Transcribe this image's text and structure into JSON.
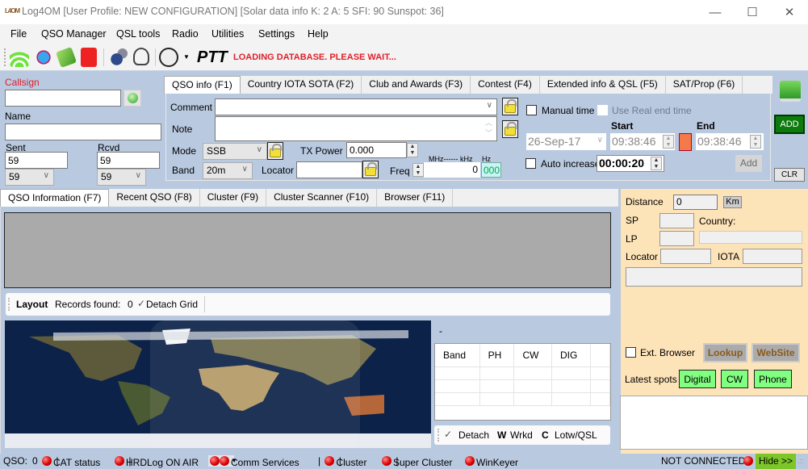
{
  "window": {
    "logo": "L4OM",
    "title": "Log4OM [User Profile: NEW CONFIGURATION] [Solar data info K: 2 A: 5 SFI: 90 Sunspot: 36]",
    "controls": {
      "minimize": "—",
      "maximize": "☐",
      "close": "✕"
    }
  },
  "menu": [
    "File",
    "QSO Manager",
    "QSL tools",
    "Radio",
    "Utilities",
    "Settings",
    "Help"
  ],
  "toolbar": {
    "icons": [
      "wifi-icon",
      "globe-icon",
      "book-icon",
      "mailbox-icon",
      "gears-icon",
      "headset-icon",
      "satellite-dish-icon"
    ],
    "ptt_label": "PTT",
    "status_message": "LOADING DATABASE. PLEASE WAIT..."
  },
  "left": {
    "callsign_label": "Callsign",
    "callsign_value": "",
    "name_label": "Name",
    "name_value": "",
    "sent_label": "Sent",
    "sent_value": "59",
    "sent_combo": "59",
    "rcvd_label": "Rcvd",
    "rcvd_value": "59",
    "rcvd_combo": "59"
  },
  "qso_tabs": [
    "QSO info (F1)",
    "Country IOTA SOTA (F2)",
    "Club and Awards (F3)",
    "Contest (F4)",
    "Extended info & QSL (F5)",
    "SAT/Prop (F6)"
  ],
  "qso_info": {
    "comment_label": "Comment",
    "comment_value": "",
    "note_label": "Note",
    "note_value": "",
    "mode_label": "Mode",
    "mode_value": "SSB",
    "txpower_label": "TX Power",
    "txpower_value": "0.000",
    "band_label": "Band",
    "band_value": "20m",
    "locator_label": "Locator",
    "locator_value": "",
    "freq_label": "Freq",
    "freq_units": "MHz------ kHz",
    "freq_hz_label": "Hz",
    "freq_value": "0",
    "freq_hz_value": "000",
    "manual_time_label": "Manual time",
    "real_end_label": "Use Real end time",
    "start_label": "Start",
    "end_label": "End",
    "date_value": "26-Sep-17",
    "start_time": "09:38:46",
    "end_time": "09:38:46",
    "auto_increase_label": "Auto increase",
    "auto_increase_value": "00:00:20",
    "add_small_label": "Add"
  },
  "side_buttons": {
    "add_label": "ADD",
    "clr_label": "CLR"
  },
  "info_tabs": [
    "QSO Information (F7)",
    "Recent QSO (F8)",
    "Cluster (F9)",
    "Cluster Scanner (F10)",
    "Browser (F11)"
  ],
  "layout_bar": {
    "layout_label": "Layout",
    "records_label": "Records found:",
    "records_count": "0",
    "detach_grid_label": "Detach Grid"
  },
  "band_grid": {
    "title": "-",
    "columns": [
      "Band",
      "PH",
      "CW",
      "DIG"
    ],
    "rows": [
      [
        "",
        "",
        "",
        ""
      ],
      [
        "",
        "",
        "",
        ""
      ],
      [
        "",
        "",
        "",
        ""
      ]
    ],
    "detach_label": "Detach",
    "wrkd_key": "W",
    "wrkd_label": "Wrkd",
    "lotw_key": "C",
    "lotw_label": "Lotw/QSL"
  },
  "right_panel": {
    "distance_label": "Distance",
    "distance_value": "0",
    "km_label": "Km",
    "sp_label": "SP",
    "lp_label": "LP",
    "country_label": "Country:",
    "locator_label": "Locator",
    "iota_label": "IOTA",
    "ext_browser_label": "Ext. Browser",
    "lookup_label": "Lookup",
    "website_label": "WebSite",
    "latest_spots_label": "Latest spots",
    "spot_buttons": [
      "Digital",
      "CW",
      "Phone"
    ]
  },
  "statusbar": {
    "qso_label": "QSO:",
    "qso_count": "0",
    "cat_status": "CAT status",
    "hrdlog": "HRDLog ON AIR",
    "comm_services": "Comm Services",
    "cluster": "Cluster",
    "super_cluster": "Super Cluster",
    "winkeyer": "WinKeyer",
    "connection": "NOT CONNECTED",
    "hide": "Hide >>"
  },
  "colors": {
    "accent_red": "#e0202a",
    "panel_blue": "#b9c9e0",
    "panel_orange": "#fde3b8",
    "spot_green": "#80ff80",
    "add_green": "#0c7a0c"
  }
}
